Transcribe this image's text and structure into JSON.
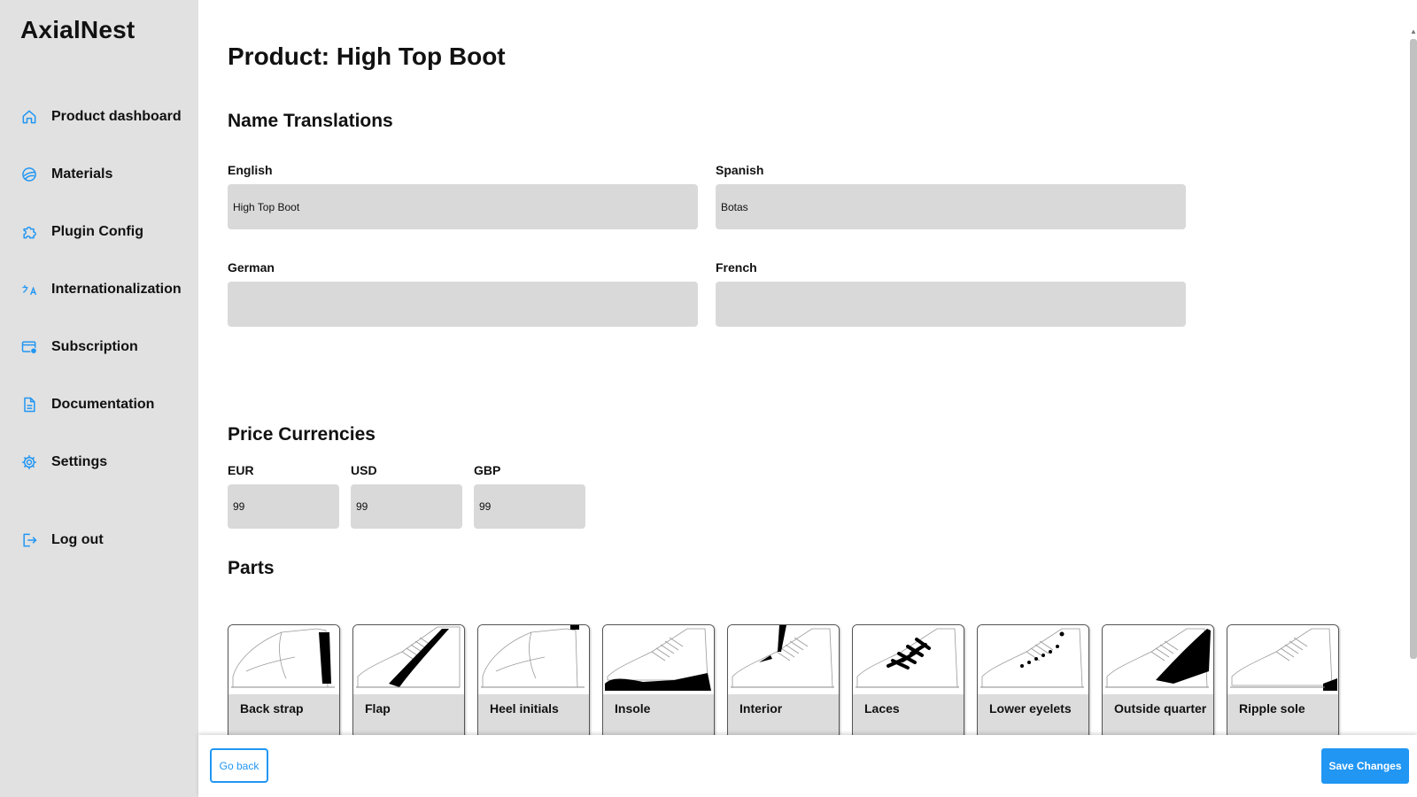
{
  "sidebar": {
    "brand": "AxialNest",
    "accent_color": "#2196f3",
    "items": [
      {
        "label": "Product dashboard",
        "icon": "home-icon"
      },
      {
        "label": "Materials",
        "icon": "palette-icon"
      },
      {
        "label": "Plugin Config",
        "icon": "puzzle-icon"
      },
      {
        "label": "Internationalization",
        "icon": "translate-icon"
      },
      {
        "label": "Subscription",
        "icon": "subscription-card-icon"
      },
      {
        "label": "Documentation",
        "icon": "document-icon"
      },
      {
        "label": "Settings",
        "icon": "gear-icon"
      },
      {
        "label": "Log out",
        "icon": "logout-icon"
      }
    ]
  },
  "main": {
    "title": "Product: High Top Boot",
    "name_translations": {
      "heading": "Name Translations",
      "fields": [
        {
          "label": "English",
          "value": "High Top Boot",
          "placeholder": ""
        },
        {
          "label": "Spanish",
          "value": "Botas",
          "placeholder": ""
        },
        {
          "label": "German",
          "value": "",
          "placeholder": ""
        },
        {
          "label": "French",
          "value": "",
          "placeholder": ""
        }
      ]
    },
    "price_currencies": {
      "heading": "Price Currencies",
      "fields": [
        {
          "label": "EUR",
          "value": "99"
        },
        {
          "label": "USD",
          "value": "99"
        },
        {
          "label": "GBP",
          "value": "99"
        }
      ]
    },
    "parts": {
      "heading": "Parts",
      "items": [
        {
          "label": "Back strap"
        },
        {
          "label": "Flap"
        },
        {
          "label": "Heel initials"
        },
        {
          "label": "Insole"
        },
        {
          "label": "Interior"
        },
        {
          "label": "Laces"
        },
        {
          "label": "Lower eyelets"
        },
        {
          "label": "Outside quarter"
        },
        {
          "label": "Ripple sole"
        }
      ]
    }
  },
  "footer": {
    "back_label": "Go back",
    "save_label": "Save Changes"
  }
}
